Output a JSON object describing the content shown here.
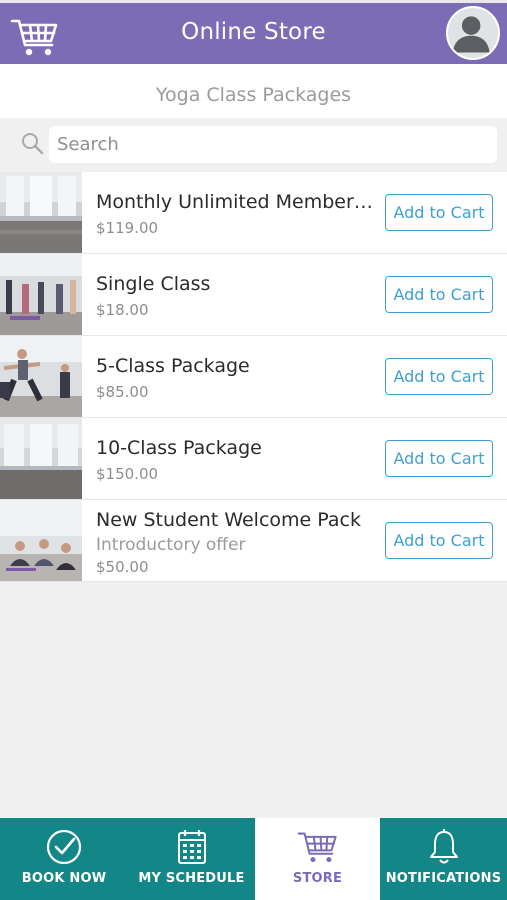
{
  "header": {
    "title": "Online Store",
    "cart_icon": "cart-icon",
    "avatar_icon": "user-avatar"
  },
  "subheader": {
    "title": "Yoga Class Packages"
  },
  "search": {
    "placeholder": "Search",
    "value": "",
    "icon": "search-icon"
  },
  "products": [
    {
      "title": "Monthly Unlimited Members...",
      "subtitle": "",
      "price": "$119.00",
      "button": "Add to Cart"
    },
    {
      "title": "Single Class",
      "subtitle": "",
      "price": "$18.00",
      "button": "Add to Cart"
    },
    {
      "title": "5-Class Package",
      "subtitle": "",
      "price": "$85.00",
      "button": "Add to Cart"
    },
    {
      "title": "10-Class Package",
      "subtitle": "",
      "price": "$150.00",
      "button": "Add to Cart"
    },
    {
      "title": "New Student Welcome Pack",
      "subtitle": "Introductory offer",
      "price": "$50.00",
      "button": "Add to Cart"
    }
  ],
  "tabs": [
    {
      "label": "BOOK NOW",
      "icon": "check-circle-icon",
      "active": false
    },
    {
      "label": "MY SCHEDULE",
      "icon": "calendar-icon",
      "active": false
    },
    {
      "label": "STORE",
      "icon": "cart-icon",
      "active": true
    },
    {
      "label": "NOTIFICATIONS",
      "icon": "bell-icon",
      "active": false
    }
  ],
  "colors": {
    "header_bg": "#7c6cb5",
    "tab_bg": "#138787",
    "button_accent": "#3f9fd4",
    "page_bg": "#f0f0f1"
  }
}
